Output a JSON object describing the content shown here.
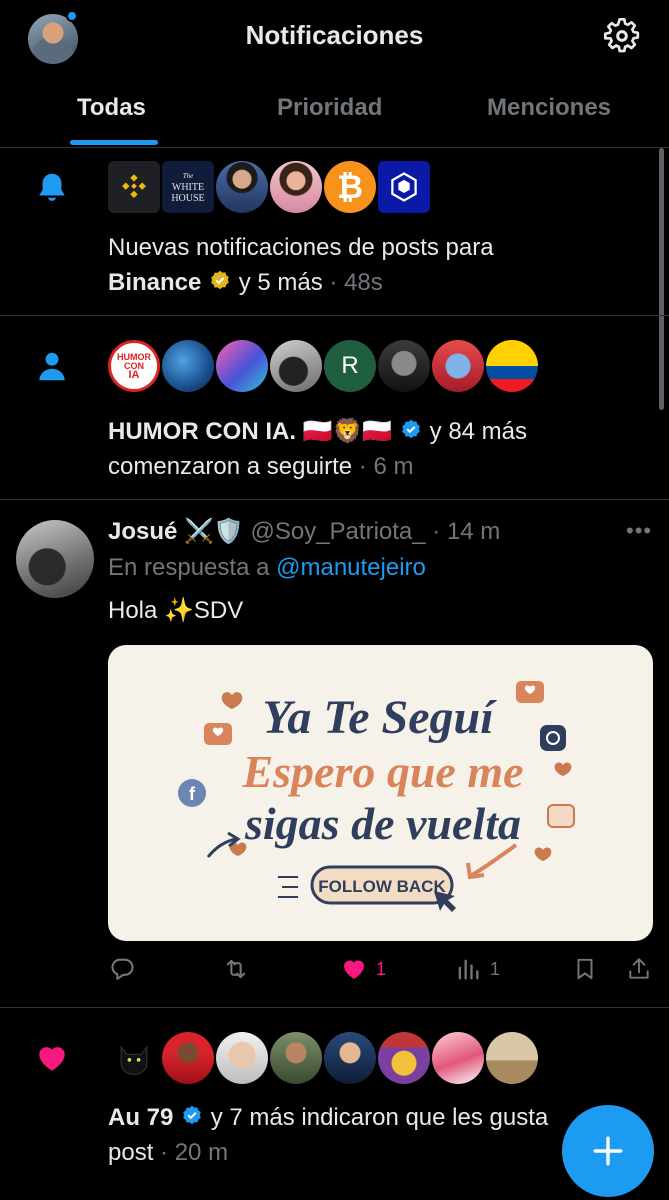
{
  "header": {
    "title": "Notificaciones",
    "tabs": [
      {
        "label": "Todas",
        "active": true
      },
      {
        "label": "Prioridad",
        "active": false
      },
      {
        "label": "Menciones",
        "active": false
      }
    ]
  },
  "notifications": [
    {
      "icon": "bell-icon",
      "text_prefix": "Nuevas notificaciones de posts para",
      "name": "Binance",
      "text_suffix": " y 5 más",
      "time": " · 48s",
      "avatars": [
        "Binance",
        "The WHITE HOUSE",
        "person",
        "person",
        "Bitcoin",
        "Crypto.com"
      ]
    },
    {
      "icon": "person-icon",
      "name": "HUMOR CON IA. 🇵🇱🦁🇵🇱",
      "text_suffix": " y 84 más",
      "text_line2": "comenzaron a seguirte",
      "time": " · 6 m",
      "avatars": [
        "HUMOR CON IA",
        "earth",
        "art",
        "person",
        "R",
        "person",
        "robot",
        "Ecuador"
      ]
    },
    {
      "icon": "heart-icon",
      "name": "Au 79",
      "text_suffix": " y 7 más indicaron que les gusta",
      "text_line2": "post",
      "time": " · 20 m"
    }
  ],
  "post": {
    "author": "Josué",
    "author_badges": "⚔️🛡️",
    "handle": "@Soy_Patriota_",
    "time": " · 14 m",
    "reply_prefix": "En respuesta a ",
    "reply_to": "@manutejeiro",
    "text": "Hola ✨SDV",
    "media": {
      "line1": "Ya Te Seguí",
      "line2": "Espero que me",
      "line3": "sigas de vuelta",
      "button": "FOLLOW BACK"
    },
    "actions": {
      "likes": "1",
      "views": "1"
    }
  },
  "colors": {
    "accent": "#1d9bf0",
    "like": "#f91880",
    "muted": "#71767b",
    "text": "#e7e9ea",
    "divider": "#2f3336"
  }
}
